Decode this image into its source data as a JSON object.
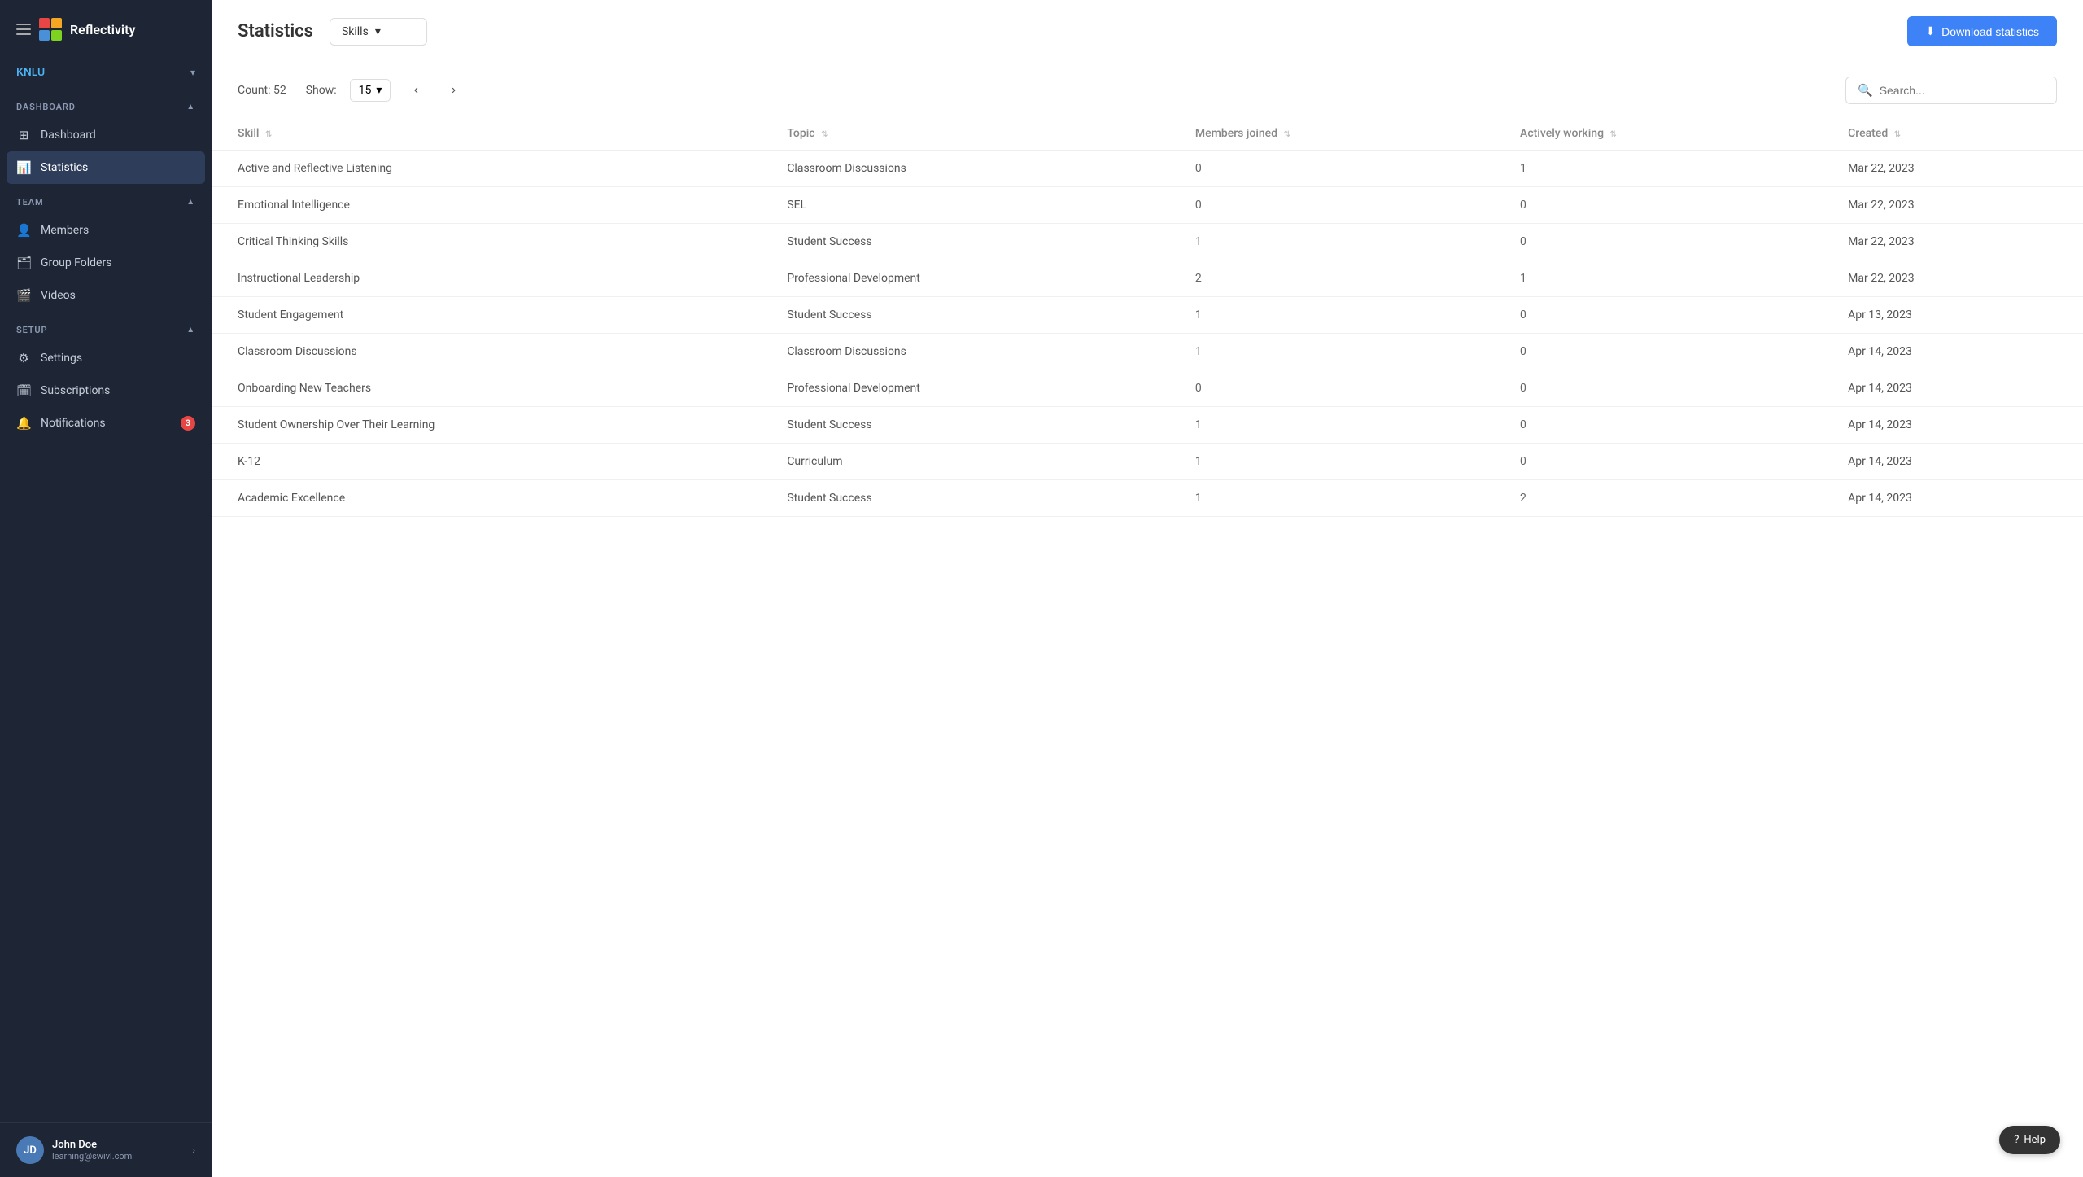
{
  "brand": {
    "name": "Reflectivity"
  },
  "org": {
    "name": "KNLU"
  },
  "sidebar": {
    "dashboard_section": "DASHBOARD",
    "team_section": "TEAM",
    "setup_section": "SETUP",
    "items": {
      "dashboard": "Dashboard",
      "statistics": "Statistics",
      "members": "Members",
      "group_folders": "Group Folders",
      "videos": "Videos",
      "settings": "Settings",
      "subscriptions": "Subscriptions",
      "notifications": "Notifications"
    },
    "notification_count": "3"
  },
  "user": {
    "name": "John Doe",
    "email": "learning@swivl.com",
    "initials": "JD"
  },
  "header": {
    "title": "Statistics",
    "filter_label": "Skills",
    "download_label": "Download statistics"
  },
  "controls": {
    "count_label": "Count: 52",
    "show_label": "Show:",
    "show_value": "15",
    "search_placeholder": "Search..."
  },
  "table": {
    "columns": [
      "Skill",
      "Topic",
      "Members joined",
      "Actively working",
      "Created"
    ],
    "rows": [
      {
        "skill": "Active and Reflective Listening",
        "topic": "Classroom Discussions",
        "members_joined": "0",
        "actively_working": "1",
        "created": "Mar 22, 2023"
      },
      {
        "skill": "Emotional Intelligence",
        "topic": "SEL",
        "members_joined": "0",
        "actively_working": "0",
        "created": "Mar 22, 2023"
      },
      {
        "skill": "Critical Thinking Skills",
        "topic": "Student Success",
        "members_joined": "1",
        "actively_working": "0",
        "created": "Mar 22, 2023"
      },
      {
        "skill": "Instructional Leadership",
        "topic": "Professional Development",
        "members_joined": "2",
        "actively_working": "1",
        "created": "Mar 22, 2023"
      },
      {
        "skill": "Student Engagement",
        "topic": "Student Success",
        "members_joined": "1",
        "actively_working": "0",
        "created": "Apr 13, 2023"
      },
      {
        "skill": "Classroom Discussions",
        "topic": "Classroom Discussions",
        "members_joined": "1",
        "actively_working": "0",
        "created": "Apr 14, 2023"
      },
      {
        "skill": "Onboarding New Teachers",
        "topic": "Professional Development",
        "members_joined": "0",
        "actively_working": "0",
        "created": "Apr 14, 2023"
      },
      {
        "skill": "Student Ownership Over Their Learning",
        "topic": "Student Success",
        "members_joined": "1",
        "actively_working": "0",
        "created": "Apr 14, 2023"
      },
      {
        "skill": "K-12",
        "topic": "Curriculum",
        "members_joined": "1",
        "actively_working": "0",
        "created": "Apr 14, 2023"
      },
      {
        "skill": "Academic Excellence",
        "topic": "Student Success",
        "members_joined": "1",
        "actively_working": "2",
        "created": "Apr 14, 2023"
      }
    ]
  },
  "help": {
    "label": "Help"
  }
}
